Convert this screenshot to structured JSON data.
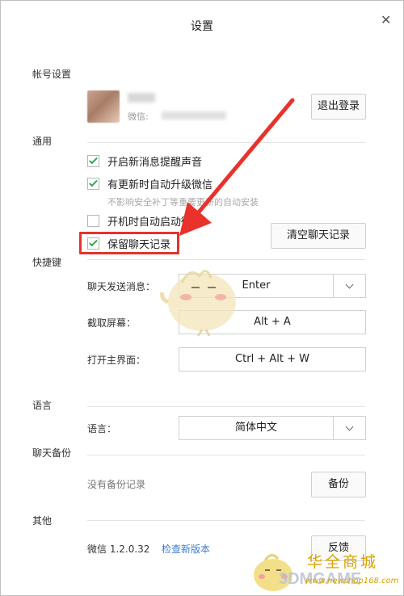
{
  "window": {
    "title": "设置"
  },
  "account": {
    "section_label": "帐号设置",
    "wechat_id_prefix": "微信:",
    "logout_button": "退出登录"
  },
  "general": {
    "section_label": "通用",
    "options": [
      {
        "label": "开启新消息提醒声音",
        "checked": true
      },
      {
        "label": "有更新时自动升级微信",
        "checked": true,
        "hint": "不影响安全补丁等重要更新的自动安装"
      },
      {
        "label": "开机时自动启动微信",
        "checked": false
      },
      {
        "label": "保留聊天记录",
        "checked": true
      }
    ],
    "clear_history_button": "清空聊天记录"
  },
  "shortcuts": {
    "section_label": "快捷键",
    "items": [
      {
        "label": "聊天发送消息：",
        "value": "Enter",
        "type": "select"
      },
      {
        "label": "截取屏幕：",
        "value": "Alt + A",
        "type": "field"
      },
      {
        "label": "打开主界面：",
        "value": "Ctrl + Alt + W",
        "type": "field"
      }
    ]
  },
  "language": {
    "section_label": "语言",
    "label": "语言：",
    "value": "简体中文"
  },
  "backup": {
    "section_label": "聊天备份",
    "status": "没有备份记录",
    "button": "备份"
  },
  "other": {
    "section_label": "其他",
    "version": "微信 1.2.0.32",
    "check_update_link": "检查新版本",
    "feedback_button": "反馈"
  },
  "watermark": {
    "brand_text": "华全商城",
    "brand_3d": "3DMGAME",
    "url": "www.newshop168.com"
  },
  "colors": {
    "accent_green": "#2ea84c",
    "highlight_red": "#e8322b",
    "link_blue": "#3d7dc8"
  }
}
